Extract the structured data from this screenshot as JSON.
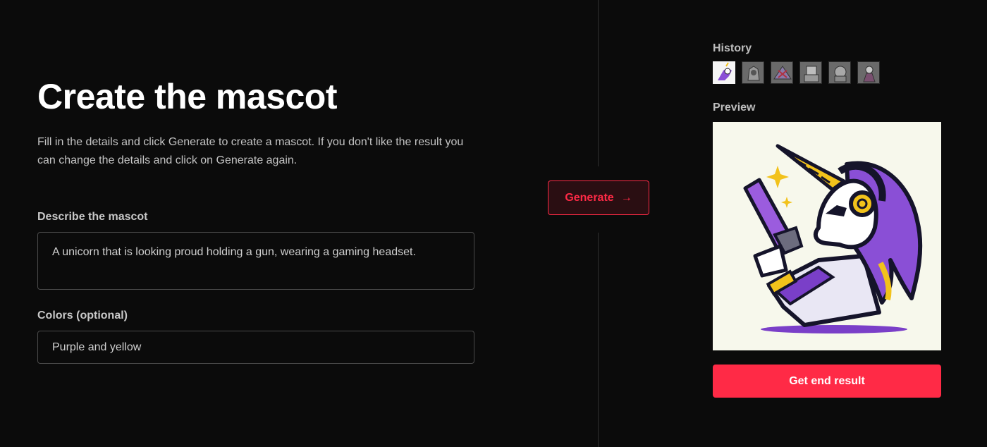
{
  "main": {
    "title": "Create the mascot",
    "intro": "Fill in the details and click Generate to create a mascot. If you don't like the result you can change the details and click on Generate again.",
    "describe_label": "Describe the mascot",
    "describe_value": "A unicorn that is looking proud holding a gun, wearing a gaming headset.",
    "colors_label": "Colors (optional)",
    "colors_value": "Purple and yellow"
  },
  "generate": {
    "label": "Generate",
    "arrow": "→"
  },
  "sidebar": {
    "history_label": "History",
    "history_items": [
      {
        "name": "unicorn mascot",
        "active": true
      },
      {
        "name": "wolf mascot",
        "active": false
      },
      {
        "name": "warrior mascot",
        "active": false
      },
      {
        "name": "robot mascot",
        "active": false
      },
      {
        "name": "armored mascot",
        "active": false
      },
      {
        "name": "fighter mascot",
        "active": false
      }
    ],
    "preview_label": "Preview",
    "end_button_label": "Get end result"
  },
  "colors": {
    "accent": "#ff2a46",
    "background": "#0b0b0b",
    "mascot_purple": "#7a3fc8",
    "mascot_yellow": "#f2c21b"
  }
}
